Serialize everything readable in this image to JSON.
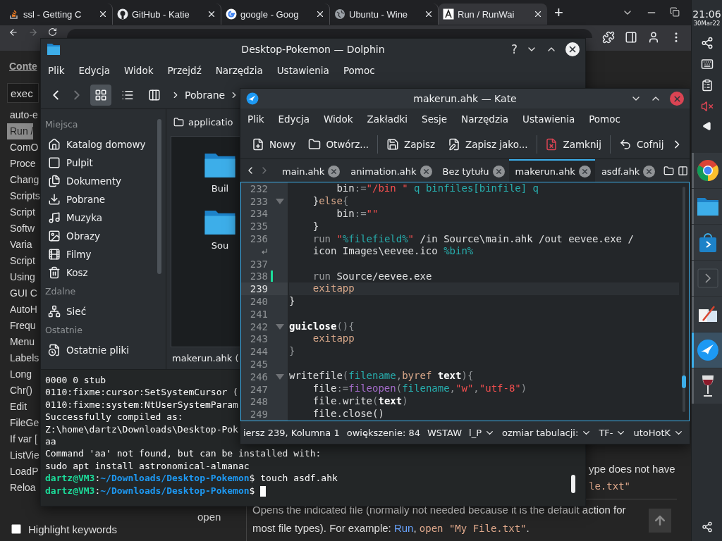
{
  "browser": {
    "tabs": [
      {
        "title": "ssl - Getting C",
        "selected": false
      },
      {
        "title": "GitHub - Katie",
        "selected": false
      },
      {
        "title": "google - Goog",
        "selected": false
      },
      {
        "title": "Ubuntu - Wine",
        "selected": false
      },
      {
        "title": "Run / RunWai",
        "selected": true
      }
    ],
    "new_tab": "+",
    "page": {
      "sidebar_tab": "Conte",
      "search": {
        "value": "exec"
      },
      "index_items": [
        {
          "label": "auto-e",
          "selected": false
        },
        {
          "label": "Run /",
          "selected": true
        },
        {
          "label": "ComO",
          "selected": false
        },
        {
          "label": "Proce",
          "selected": false
        },
        {
          "label": "Chang",
          "selected": false
        },
        {
          "label": "Scripts",
          "selected": false
        },
        {
          "label": "Script",
          "selected": false
        },
        {
          "label": "Softw",
          "selected": false
        },
        {
          "label": "Varia",
          "selected": false
        },
        {
          "label": "Script",
          "selected": false
        },
        {
          "label": "Using",
          "selected": false
        },
        {
          "label": "GUI C",
          "selected": false
        },
        {
          "label": "AutoH",
          "selected": false
        },
        {
          "label": "Frequ",
          "selected": false
        },
        {
          "label": "Menu",
          "selected": false
        },
        {
          "label": "Labels",
          "selected": false
        },
        {
          "label": "Long",
          "selected": false
        },
        {
          "label": "Chr()",
          "selected": false
        },
        {
          "label": "Edit",
          "selected": false
        },
        {
          "label": "FileGe",
          "selected": false
        },
        {
          "label": "If var [",
          "selected": false
        },
        {
          "label": "ListVie",
          "selected": false
        },
        {
          "label": "LoadP",
          "selected": false
        },
        {
          "label": "Reloa",
          "selected": false
        }
      ],
      "highlight_keywords": {
        "label": "Highlight keywords",
        "checked": false
      },
      "fragment_text": "ype does not have",
      "fragment_code": "le.txt\"",
      "table_row": {
        "option": "open",
        "description": [
          {
            "kind": "plain",
            "text": "Opens the indicated file (normally not needed because it is the default action for most file types). For example: "
          },
          {
            "kind": "link",
            "text": "Run"
          },
          {
            "kind": "plain",
            "text": ", "
          },
          {
            "kind": "code",
            "text": "open \"My File.txt\""
          },
          {
            "kind": "plain",
            "text": "."
          }
        ]
      }
    }
  },
  "dolphin": {
    "title": "Desktop-Pokemon — Dolphin",
    "help": "?",
    "menu": [
      "Plik",
      "Edycja",
      "Widok",
      "Przejdź",
      "Narzędzia",
      "Ustawienia",
      "Pomoc"
    ],
    "breadcrumb": "Pobrane",
    "places": [
      {
        "heading": "Miejsca",
        "items": [
          "Katalog domowy",
          "Pulpit",
          "Dokumenty",
          "Pobrane",
          "Muzyka",
          "Obrazy",
          "Filmy",
          "Kosz"
        ]
      },
      {
        "heading": "Zdalne",
        "items": [
          "Sieć"
        ]
      },
      {
        "heading": "Ostatnie",
        "items": [
          "Ostatnie pliki"
        ]
      }
    ],
    "location": "applicatio",
    "files": [
      "Buil",
      "Sou"
    ],
    "status": "makerun.ahk (",
    "terminal": [
      {
        "kind": "output",
        "text": "0000 0 stub"
      },
      {
        "kind": "output",
        "text": "0110:fixme:cursor:SetSystemCursor ("
      },
      {
        "kind": "output",
        "text": "0110:fixme:system:NtUserSystemParam"
      },
      {
        "kind": "output",
        "text": "Successfully compiled as:"
      },
      {
        "kind": "output",
        "text": "Z:\\home\\dartz\\Downloads\\Desktop-Pok"
      },
      {
        "kind": "output",
        "text": "aa"
      },
      {
        "kind": "output",
        "text": "Command 'aa' not found, but can be installed with:"
      },
      {
        "kind": "output",
        "text": "sudo apt install astronomical-almanac"
      },
      {
        "kind": "prompt",
        "user": "dartz@VM3",
        "separator": ":",
        "path": "~/Downloads/Desktop-Pokemon",
        "symbol": "$",
        "command": "touch asdf.ahk",
        "cursor": false
      },
      {
        "kind": "prompt",
        "user": "dartz@VM3",
        "separator": ":",
        "path": "~/Downloads/Desktop-Pokemon",
        "symbol": "$",
        "cursor": true
      }
    ]
  },
  "kate": {
    "title": "makerun.ahk — Kate",
    "menu": [
      "Plik",
      "Edycja",
      "Widok",
      "Zakładki",
      "Sesje",
      "Narzędzia",
      "Ustawienia",
      "Pomoc"
    ],
    "toolbar": [
      {
        "kind": "new",
        "label": "Nowy"
      },
      {
        "kind": "open",
        "label": "Otwórz..."
      },
      {
        "kind": "save",
        "label": "Zapisz"
      },
      {
        "kind": "saveas",
        "label": "Zapisz jako..."
      },
      {
        "kind": "close",
        "label": "Zamknij"
      },
      {
        "kind": "undo",
        "label": "Cofnij"
      }
    ],
    "tabs": [
      {
        "title": "main.ahk",
        "selected": false
      },
      {
        "title": "animation.ahk",
        "selected": false
      },
      {
        "title": "Bez tytułu",
        "selected": false
      },
      {
        "title": "makerun.ahk",
        "selected": true
      },
      {
        "title": "asdf.ahk",
        "selected": false
      }
    ],
    "lines": [
      {
        "kind": "line",
        "number": "232",
        "current": false,
        "modified": false,
        "fold": false,
        "segments": [
          {
            "kind": "plain",
            "text": "        bin"
          },
          {
            "kind": "op",
            "text": ":="
          },
          {
            "kind": "string",
            "text": "\"/bin \""
          },
          {
            "kind": "var",
            "text": " q binfiles[binfile] q"
          }
        ]
      },
      {
        "kind": "line",
        "number": "233",
        "current": false,
        "modified": false,
        "fold": true,
        "segments": [
          {
            "kind": "plain",
            "text": "    }"
          },
          {
            "kind": "keyword",
            "text": "else"
          },
          {
            "kind": "op",
            "text": "{"
          }
        ]
      },
      {
        "kind": "line",
        "number": "234",
        "current": false,
        "modified": false,
        "fold": false,
        "segments": [
          {
            "kind": "plain",
            "text": "        bin"
          },
          {
            "kind": "op",
            "text": ":="
          },
          {
            "kind": "string",
            "text": "\"\""
          }
        ]
      },
      {
        "kind": "line",
        "number": "235",
        "current": false,
        "modified": false,
        "fold": false,
        "segments": [
          {
            "kind": "plain",
            "text": "    }"
          }
        ]
      },
      {
        "kind": "line",
        "number": "236",
        "current": false,
        "modified": false,
        "fold": false,
        "segments": [
          {
            "kind": "builtin",
            "text": "    run "
          },
          {
            "kind": "string",
            "text": "\""
          },
          {
            "kind": "var",
            "text": "%filefield%"
          },
          {
            "kind": "string",
            "text": "\""
          },
          {
            "kind": "plain",
            "text": " /in Source\\main.ahk /out eevee.exe /"
          }
        ]
      },
      {
        "kind": "wrap",
        "current": false,
        "modified": false,
        "fold": false,
        "segments": [
          {
            "kind": "plain",
            "text": "    icon Images\\eevee.ico "
          },
          {
            "kind": "var",
            "text": "%bin%"
          }
        ]
      },
      {
        "kind": "line",
        "number": "237",
        "current": false,
        "modified": false,
        "fold": false
      },
      {
        "kind": "line",
        "number": "238",
        "current": false,
        "modified": true,
        "fold": false,
        "segments": [
          {
            "kind": "builtin",
            "text": "    run"
          },
          {
            "kind": "plain",
            "text": " Source/eevee.exe"
          }
        ]
      },
      {
        "kind": "line",
        "number": "239",
        "current": true,
        "modified": false,
        "fold": false,
        "segments": [
          {
            "kind": "keyword",
            "text": "    exitapp"
          }
        ]
      },
      {
        "kind": "line",
        "number": "240",
        "current": false,
        "modified": false,
        "fold": false,
        "segments": [
          {
            "kind": "plain",
            "text": "}"
          }
        ]
      },
      {
        "kind": "line",
        "number": "241",
        "current": false,
        "modified": false,
        "fold": false
      },
      {
        "kind": "line",
        "number": "242",
        "current": false,
        "modified": false,
        "fold": true,
        "segments": [
          {
            "kind": "bold",
            "text": "guiclose"
          },
          {
            "kind": "op",
            "text": "(){"
          }
        ]
      },
      {
        "kind": "line",
        "number": "243",
        "current": false,
        "modified": false,
        "fold": false,
        "segments": [
          {
            "kind": "keyword",
            "text": "    exitapp"
          }
        ]
      },
      {
        "kind": "line",
        "number": "244",
        "current": false,
        "modified": false,
        "fold": false,
        "segments": [
          {
            "kind": "op",
            "text": "}"
          }
        ]
      },
      {
        "kind": "line",
        "number": "245",
        "current": false,
        "modified": false,
        "fold": false
      },
      {
        "kind": "line",
        "number": "246",
        "current": false,
        "modified": false,
        "fold": true,
        "segments": [
          {
            "kind": "plain",
            "text": "writefile"
          },
          {
            "kind": "op",
            "text": "("
          },
          {
            "kind": "var",
            "text": "filename"
          },
          {
            "kind": "op",
            "text": ","
          },
          {
            "kind": "keyword",
            "text": "byref "
          },
          {
            "kind": "bold",
            "text": "text"
          },
          {
            "kind": "op",
            "text": "){"
          }
        ]
      },
      {
        "kind": "line",
        "number": "247",
        "current": false,
        "modified": false,
        "fold": false,
        "segments": [
          {
            "kind": "plain",
            "text": "    file"
          },
          {
            "kind": "op",
            "text": ":="
          },
          {
            "kind": "func",
            "text": "fileopen"
          },
          {
            "kind": "op",
            "text": "("
          },
          {
            "kind": "var",
            "text": "filename"
          },
          {
            "kind": "op",
            "text": ","
          },
          {
            "kind": "string",
            "text": "\"w\""
          },
          {
            "kind": "op",
            "text": ","
          },
          {
            "kind": "string",
            "text": "\"utf-8\""
          },
          {
            "kind": "op",
            "text": ")"
          }
        ]
      },
      {
        "kind": "line",
        "number": "248",
        "current": false,
        "modified": false,
        "fold": false,
        "segments": [
          {
            "kind": "plain",
            "text": "    file"
          },
          {
            "kind": "op",
            "text": "."
          },
          {
            "kind": "plain",
            "text": "write"
          },
          {
            "kind": "op",
            "text": "("
          },
          {
            "kind": "bold",
            "text": "text"
          },
          {
            "kind": "op",
            "text": ")"
          }
        ]
      },
      {
        "kind": "line",
        "number": "249",
        "current": false,
        "modified": false,
        "fold": false,
        "segments": [
          {
            "kind": "plain",
            "text": "    file.close()"
          }
        ]
      }
    ],
    "status": [
      {
        "kind": "text",
        "text": "iersz 239, Kolumna 1"
      },
      {
        "kind": "text",
        "text": "owiększenie: 84"
      },
      {
        "kind": "text",
        "text": "WSTAW"
      },
      {
        "kind": "dropdown",
        "text": "l_P"
      },
      {
        "kind": "dropdown",
        "text": "ozmiar tabulacji:"
      },
      {
        "kind": "dropdown",
        "text": "TF-"
      },
      {
        "kind": "dropdown",
        "text": "utoHotK"
      }
    ]
  },
  "panel": {
    "time": "21:06",
    "date": "30Mar22",
    "tasks": [
      {
        "selected": false
      },
      {
        "selected": false
      },
      {
        "selected": false
      },
      {
        "selected": false
      },
      {
        "selected": false
      },
      {
        "selected": true
      },
      {
        "selected": false
      }
    ]
  }
}
